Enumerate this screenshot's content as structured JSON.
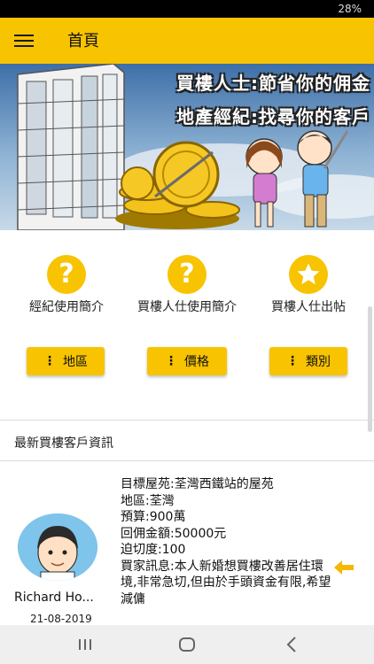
{
  "status_bar": {
    "battery": "28%"
  },
  "app_bar": {
    "title": "首頁"
  },
  "banner": {
    "line1": "買樓人士:節省你的佣金",
    "line2": "地產經紀:找尋你的客戶"
  },
  "features": [
    {
      "label": "經紀使用簡介",
      "icon": "question-icon"
    },
    {
      "label": "買樓人仕使用簡介",
      "icon": "question-icon"
    },
    {
      "label": "買樓人仕出帖",
      "icon": "star-icon"
    }
  ],
  "filters": [
    {
      "label": "地區"
    },
    {
      "label": "價格"
    },
    {
      "label": "類別"
    }
  ],
  "section": {
    "title": "最新買樓客戶資訊"
  },
  "post": {
    "target_estate": "目標屋苑:荃灣西鐵站的屋苑",
    "district": "地區:荃灣",
    "budget": "預算:900萬",
    "commission": "回佣金額:50000元",
    "urgency": "迫切度:100",
    "message": "買家訊息:本人新婚想買樓改善居住環境,非常急切,但由於手頭資金有限,希望減傭",
    "poster_name": "Richard Ho...",
    "date": "21-08-2019"
  },
  "colors": {
    "accent": "#f8c300",
    "arrow": "#f5b800"
  }
}
